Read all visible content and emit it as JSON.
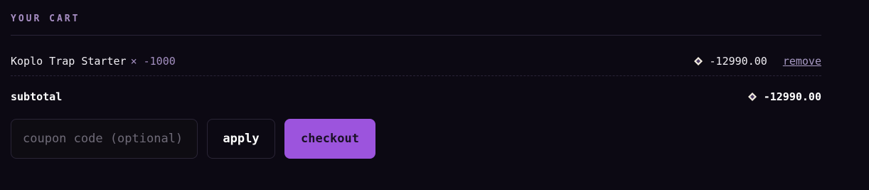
{
  "cart": {
    "title": "YOUR CART",
    "items": [
      {
        "name": "Koplo Trap Starter",
        "qty": "× -1000",
        "price": "-12990.00",
        "currency_icon": "diamond-gem-icon",
        "remove_label": "remove"
      }
    ],
    "subtotal_label": "subtotal",
    "subtotal_value": "-12990.00",
    "coupon": {
      "value": "",
      "placeholder": "coupon code (optional)"
    },
    "apply_label": "apply",
    "checkout_label": "checkout"
  },
  "colors": {
    "background": "#0c0913",
    "accent": "#9c54dd",
    "muted_purple": "#a88fc4"
  }
}
